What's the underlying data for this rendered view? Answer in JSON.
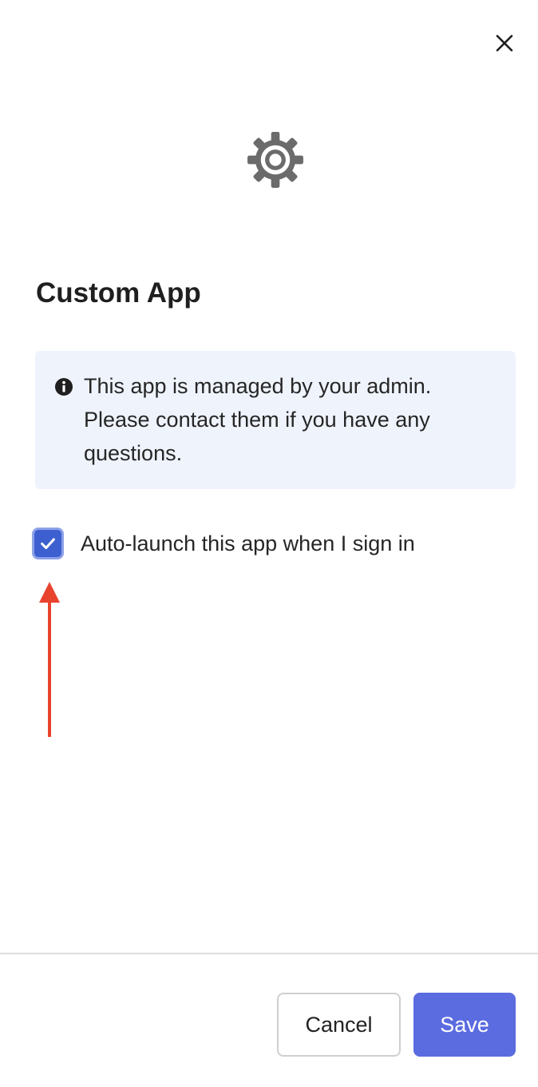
{
  "dialog": {
    "title": "Custom App",
    "app_icon": "gear-icon",
    "close_icon": "close-icon"
  },
  "notice": {
    "icon": "info-icon",
    "text": "This app is managed by your admin. Please contact them if you have any questions."
  },
  "auto_launch": {
    "label": "Auto-launch this app when I sign in",
    "checked": true
  },
  "footer": {
    "cancel_label": "Cancel",
    "save_label": "Save"
  },
  "colors": {
    "accent": "#5b6be0",
    "checkbox": "#3d5fd0",
    "notice_bg": "#eff3fc",
    "annotation_arrow": "#e8432d"
  }
}
